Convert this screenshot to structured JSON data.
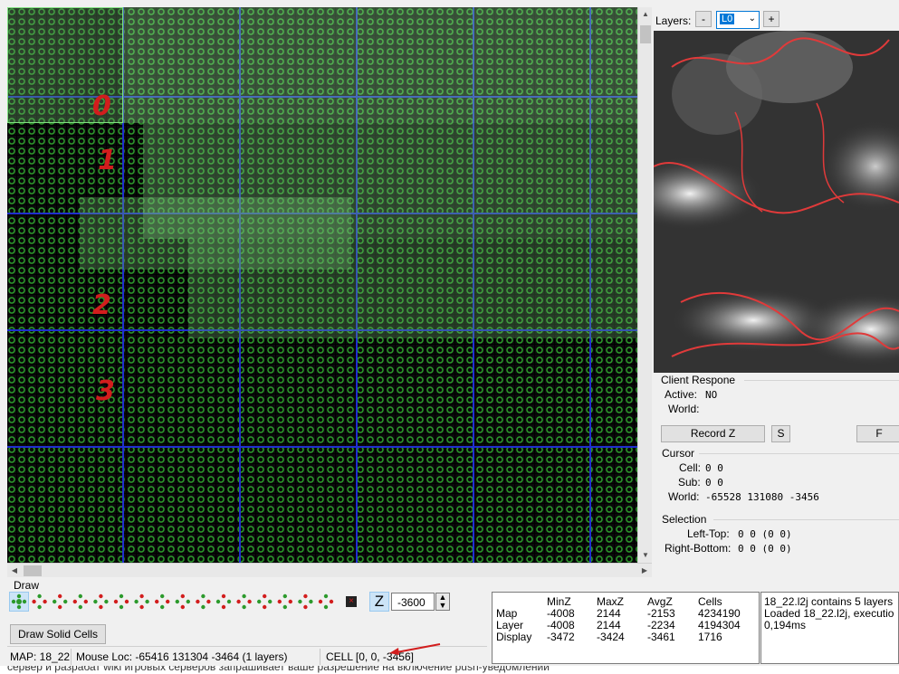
{
  "grid": {
    "region_labels": [
      "0",
      "1",
      "2",
      "3"
    ]
  },
  "layers": {
    "label": "Layers:",
    "minus": "-",
    "current": "L0",
    "plus": "+"
  },
  "client": {
    "title": "Client Respone",
    "active_label": "Active:",
    "active_value": "NO",
    "world_label": "World:",
    "record_label": "Record Z",
    "s_label": "S",
    "f_label": "F"
  },
  "cursor": {
    "title": "Cursor",
    "cell_label": "Cell:",
    "cell_value": "0 0",
    "sub_label": "Sub:",
    "sub_value": "0 0",
    "world_label": "World:",
    "world_value": "-65528 131080 -3456"
  },
  "selection": {
    "title": "Selection",
    "lt_label": "Left-Top:",
    "lt_value": "0 0 (0 0)",
    "rb_label": "Right-Bottom:",
    "rb_value": "0 0 (0 0)"
  },
  "draw": {
    "title": "Draw",
    "z_label": "Z",
    "z_value": "-3600",
    "solid_button": "Draw Solid Cells"
  },
  "stats": {
    "headers": [
      "MinZ",
      "MaxZ",
      "AvgZ",
      "Cells"
    ],
    "rows": [
      {
        "name": "Map",
        "values": [
          "-4008",
          "2144",
          "-2153",
          "4234190"
        ]
      },
      {
        "name": "Layer",
        "values": [
          "-4008",
          "2144",
          "-2234",
          "4194304"
        ]
      },
      {
        "name": "Display",
        "values": [
          "-3472",
          "-3424",
          "-3461",
          "1716"
        ]
      }
    ]
  },
  "log": {
    "line1": "18_22.l2j contains 5 layers",
    "line2": "Loaded 18_22.l2j, executio",
    "line3": "0,194ms"
  },
  "status": {
    "map": "MAP: 18_22",
    "mouse": "Mouse Loc: -65416 131304 -3464 (1 layers)",
    "cell": "CELL [0, 0, -3456]"
  },
  "bottom_text": "сервер и разрабат wiki игровых серверов запрашивает ваше разрешение на включение push-уведомлений",
  "colors": {
    "grid_green": "#2c9a2c",
    "grid_blue": "#1f2fcf",
    "annotation_red": "#d21d1d"
  }
}
